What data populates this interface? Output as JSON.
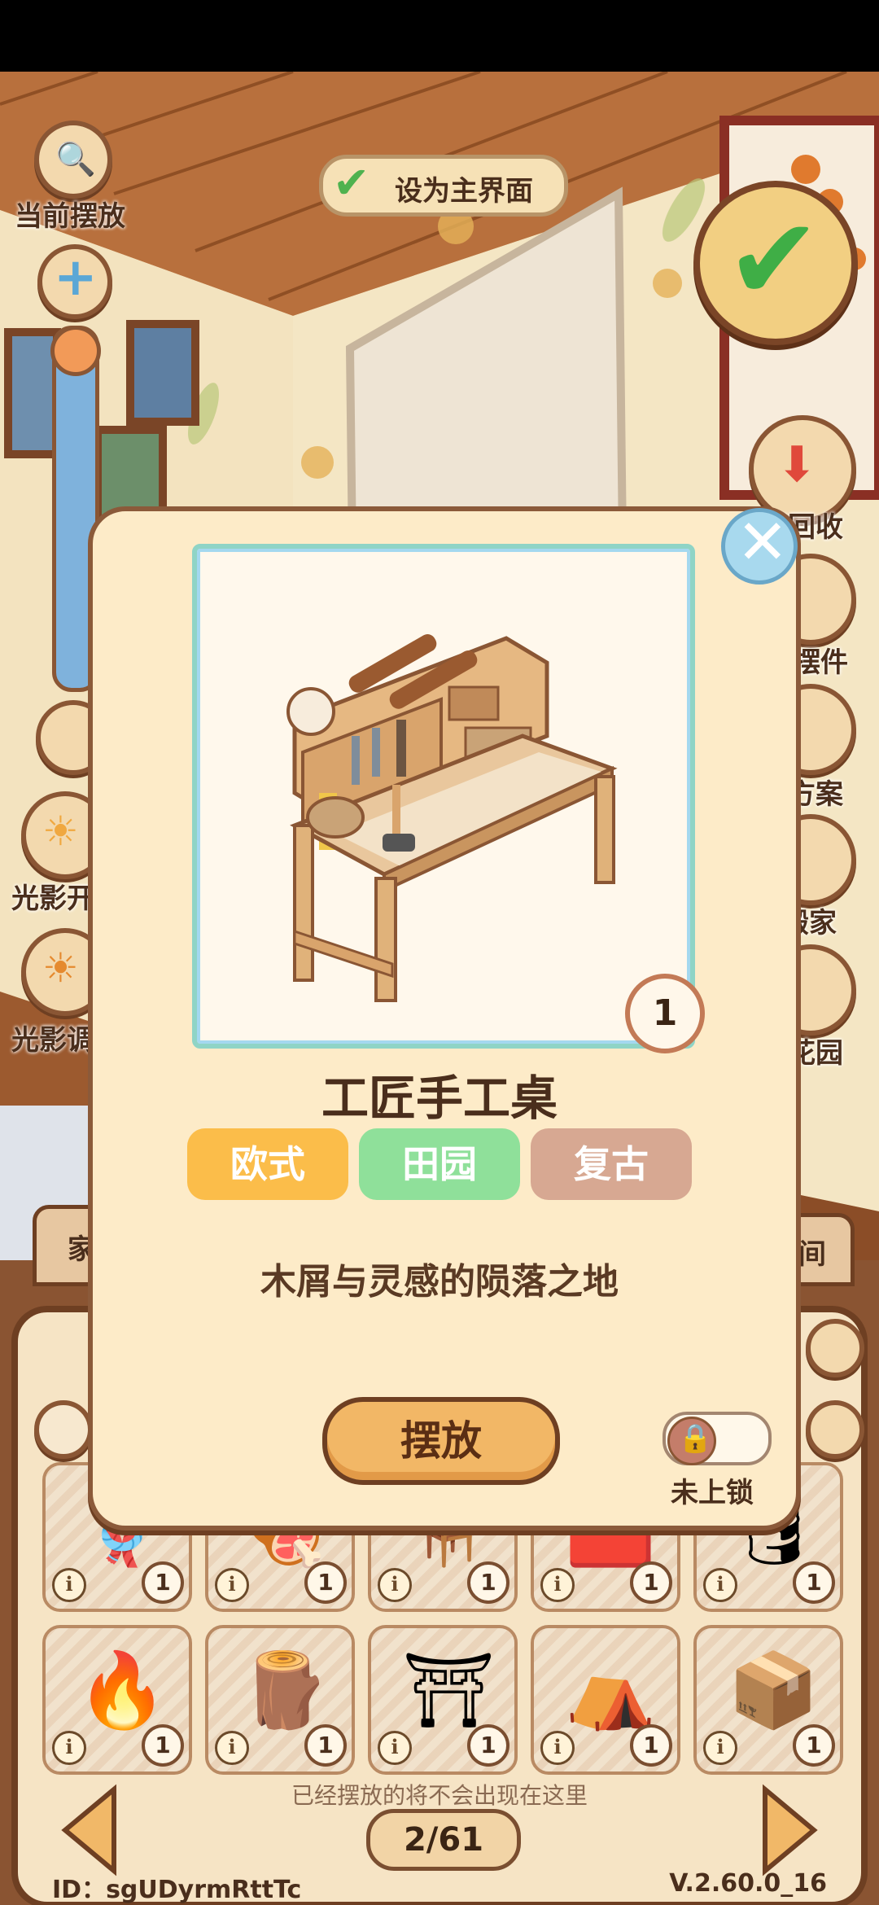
{
  "top_controls": {
    "current_placement_label": "当前摆放",
    "set_main_label": "设为主界面"
  },
  "left_menu": {
    "light_shadow_1": "光影开",
    "light_shadow_2": "光影调"
  },
  "right_menu": {
    "recycle_all": "全部回收",
    "put_item": "收摆件",
    "plan": "布置方案",
    "move": "搬家",
    "garden": "前往花园"
  },
  "bottom_panel": {
    "tab_left": "家",
    "tab_right": "间",
    "hint": "已经摆放的将不会出现在这里",
    "page": "2/61",
    "id_text": "ID：sgUDyrmRttTc",
    "version": "V.2.60.0_16",
    "items": [
      {
        "name": "rope-bundle",
        "count": "1"
      },
      {
        "name": "grill",
        "count": "1"
      },
      {
        "name": "work-table",
        "count": "1"
      },
      {
        "name": "red-platform",
        "count": "1"
      },
      {
        "name": "barrel",
        "count": "1"
      },
      {
        "name": "campfire",
        "count": "1"
      },
      {
        "name": "woodpile",
        "count": "1"
      },
      {
        "name": "wooden-gate",
        "count": "1"
      },
      {
        "name": "tent-canopy",
        "count": "1"
      },
      {
        "name": "crates",
        "count": "1"
      }
    ]
  },
  "dialog": {
    "title": "工匠手工桌",
    "owned_count": "1",
    "tags": [
      "欧式",
      "田园",
      "复古"
    ],
    "tag_colors": [
      "#fbbd4a",
      "#8fe09a",
      "#d7a892"
    ],
    "description": "木屑与灵感的陨落之地",
    "place_button": "摆放",
    "lock_label": "未上锁"
  }
}
